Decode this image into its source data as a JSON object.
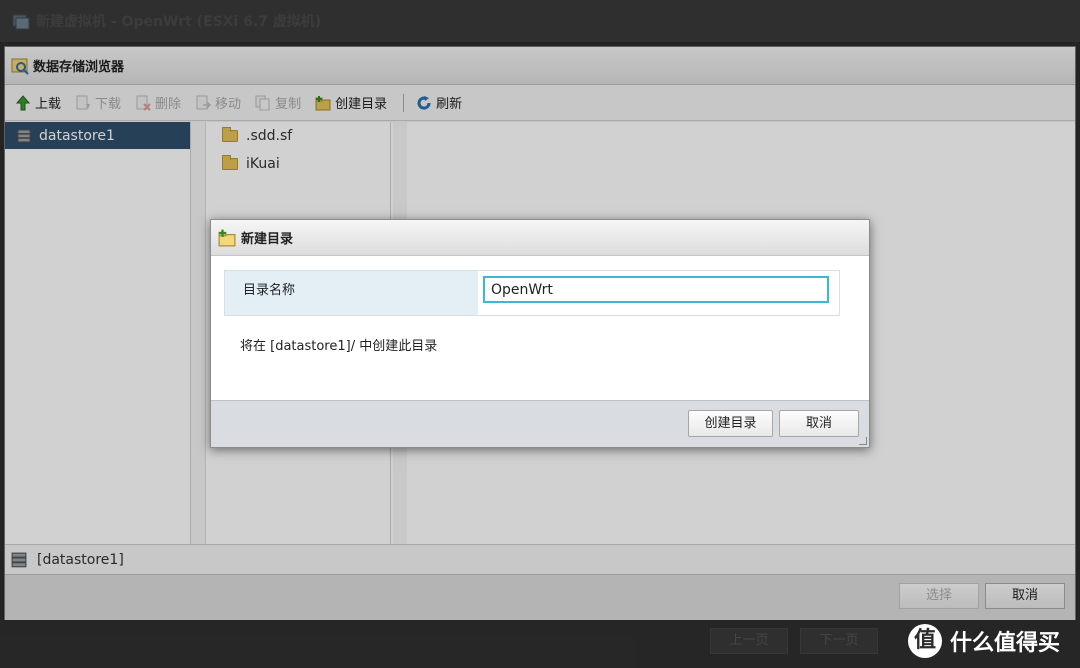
{
  "window": {
    "title": "新建虚拟机 - OpenWrt (ESXi 6.7 虚拟机)"
  },
  "behind_footer": {
    "prev_label": "上一页",
    "next_label": "下一页"
  },
  "browser": {
    "title": "数据存储浏览器",
    "toolbar": {
      "upload": "上载",
      "download": "下载",
      "delete": "删除",
      "move": "移动",
      "copy": "复制",
      "create_dir": "创建目录",
      "refresh": "刷新"
    },
    "datastores": [
      "datastore1"
    ],
    "files": [
      ".sdd.sf",
      "iKuai"
    ],
    "path": "[datastore1]",
    "footer": {
      "select_label": "选择",
      "cancel_label": "取消"
    }
  },
  "dialog": {
    "title": "新建目录",
    "field_label": "目录名称",
    "field_value": "OpenWrt",
    "note": "将在 [datastore1]/ 中创建此目录",
    "create_label": "创建目录",
    "cancel_label": "取消"
  },
  "watermark": {
    "glyph": "值",
    "text": "什么值得买"
  },
  "colors": {
    "selection": "#2f4f6b",
    "input_focus": "#3bb8d6",
    "folder": "#e8c25a"
  }
}
